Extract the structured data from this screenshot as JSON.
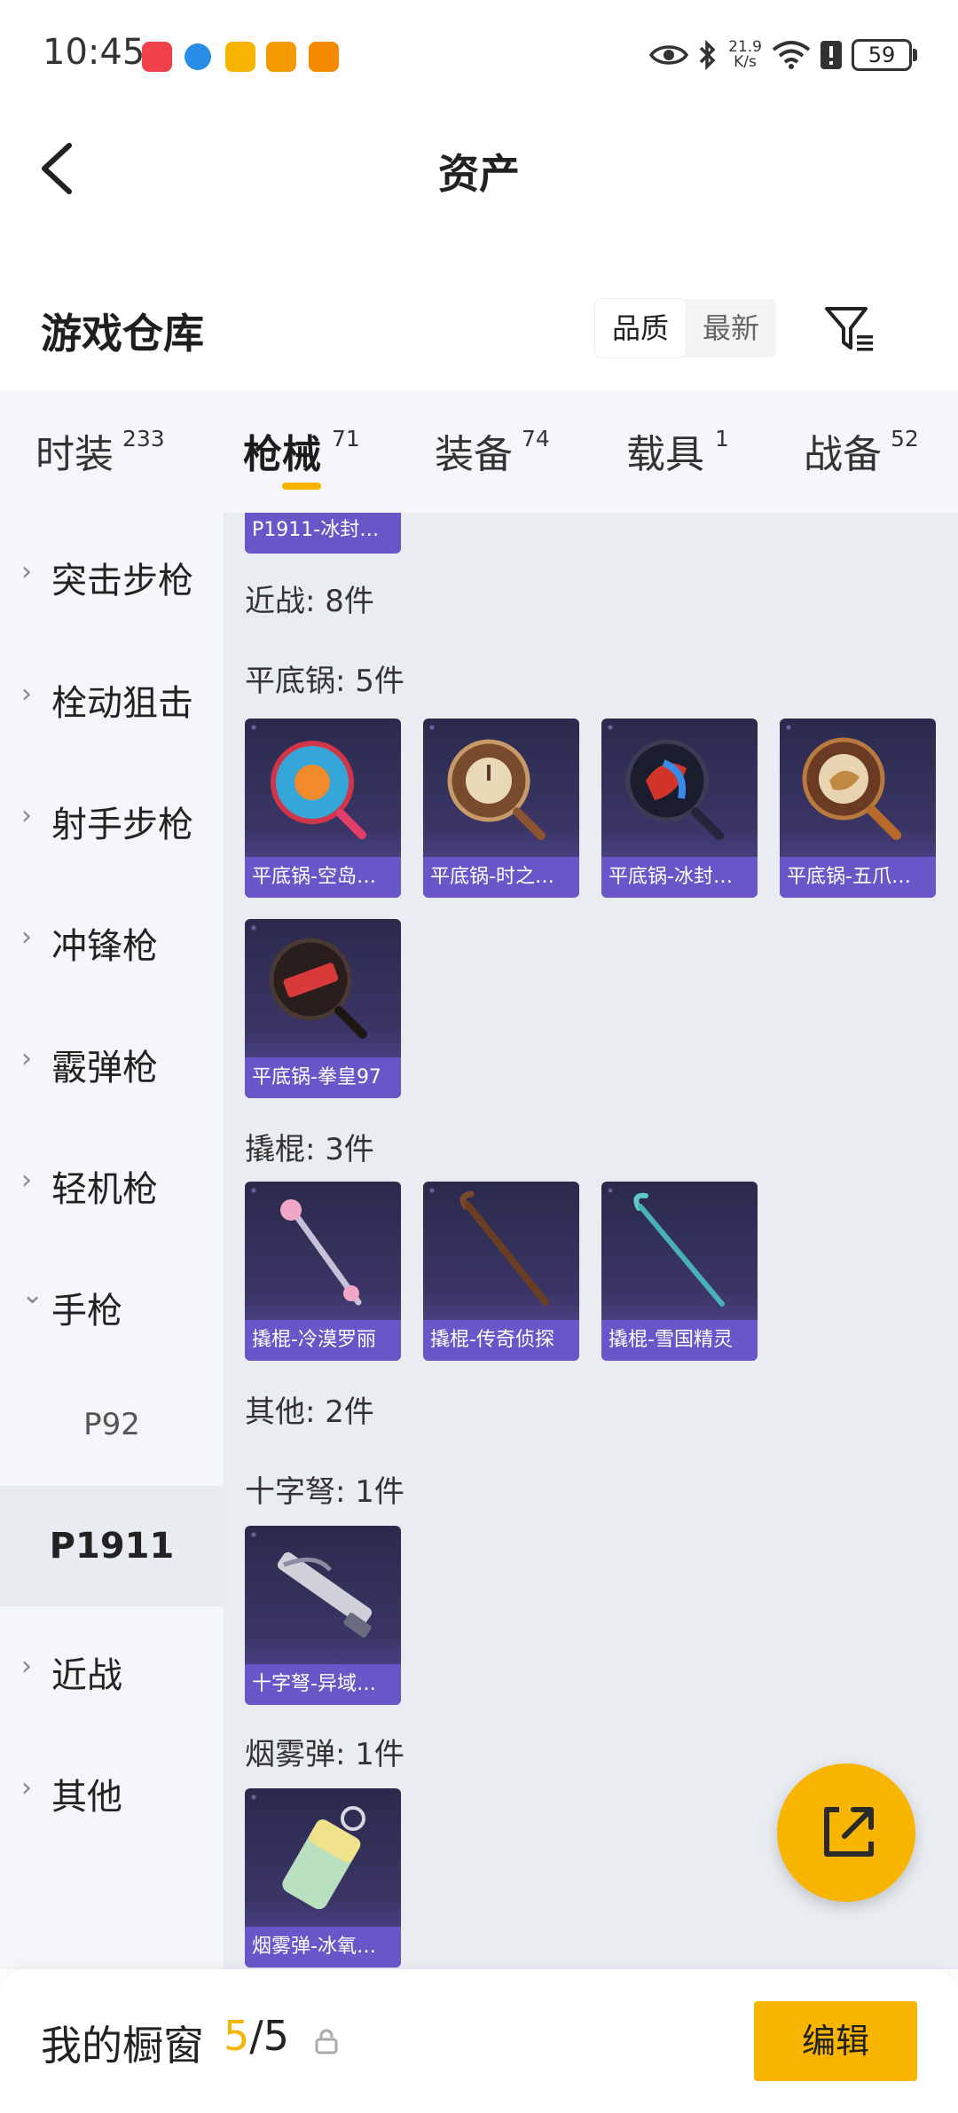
{
  "status_bar": {
    "time": "10:45",
    "net_speed_value": "21.9",
    "net_speed_unit": "K/s",
    "battery": "59",
    "notification_icons": [
      "shopping-app-icon",
      "browser-icon",
      "chat-app-icon",
      "game-center-icon",
      "video-app-icon"
    ],
    "notification_colors": [
      "#f0404a",
      "#2a8ee8",
      "#f5b400",
      "#f59a00",
      "#f58a00"
    ]
  },
  "header": {
    "title": "资产",
    "back_icon": "chevron-left-icon"
  },
  "warehouse": {
    "title": "游戏仓库",
    "sort_options": [
      "品质",
      "最新"
    ],
    "sort_selected": "品质",
    "filter_icon": "filter-icon"
  },
  "tabs": [
    {
      "label": "时装",
      "count": "233"
    },
    {
      "label": "枪械",
      "count": "71",
      "active": true
    },
    {
      "label": "装备",
      "count": "74"
    },
    {
      "label": "载具",
      "count": "1"
    },
    {
      "label": "战备",
      "count": "52"
    }
  ],
  "sidebar": {
    "items": [
      {
        "label": "突击步枪",
        "chevron": "›"
      },
      {
        "label": "栓动狙击",
        "chevron": "›"
      },
      {
        "label": "射手步枪",
        "chevron": "›"
      },
      {
        "label": "冲锋枪",
        "chevron": "›"
      },
      {
        "label": "霰弹枪",
        "chevron": "›"
      },
      {
        "label": "轻机枪",
        "chevron": "›"
      },
      {
        "label": "手枪",
        "chevron": "⌄"
      }
    ],
    "sub_items": [
      {
        "label": "P92"
      },
      {
        "label": "P1911",
        "active": true
      }
    ],
    "tail_items": [
      {
        "label": "近战",
        "chevron": "›"
      },
      {
        "label": "其他",
        "chevron": "›"
      }
    ]
  },
  "content": {
    "partial_card_label": "P1911-冰封…",
    "groups": {
      "melee": "近战: 8件",
      "pan": "平底锅: 5件",
      "crowbar": "撬棍: 3件",
      "other": "其他: 2件",
      "crossbow": "十字弩: 1件",
      "smoke": "烟雾弹: 1件"
    },
    "pan_cards": [
      "平底锅-空岛…",
      "平底锅-时之…",
      "平底锅-冰封…",
      "平底锅-五爪…",
      "平底锅-拳皇97"
    ],
    "crowbar_cards": [
      "撬棍-冷漠罗丽",
      "撬棍-传奇侦探",
      "撬棍-雪国精灵"
    ],
    "crossbow_cards": [
      "十字弩-异域…"
    ],
    "smoke_cards": [
      "烟雾弹-冰氧…"
    ]
  },
  "fab": {
    "icon": "share-external-icon"
  },
  "bottom_bar": {
    "title": "我的橱窗",
    "count_current": "5",
    "count_sep": "/",
    "count_total": "5",
    "lock_icon": "lock-icon",
    "edit_label": "编辑"
  },
  "colors": {
    "accent": "#f7b500",
    "card_label_bg": "#6a56c8",
    "card_bg": "#2a2a4c",
    "sidebar_bg": "#f4f6f9",
    "content_bg": "#e9ecf1"
  }
}
